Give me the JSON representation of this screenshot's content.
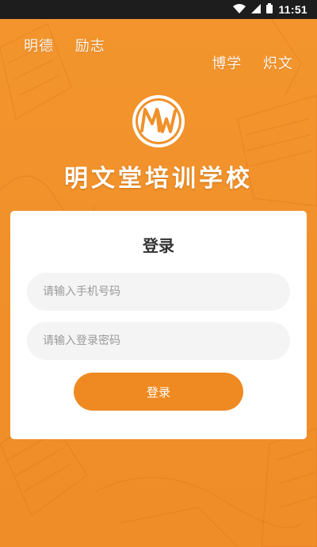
{
  "status_bar": {
    "time": "11:51",
    "icons": [
      "wifi-icon",
      "signal-icon",
      "battery-icon"
    ]
  },
  "motto": {
    "left": [
      "明德",
      "励志"
    ],
    "right": [
      "博学",
      "炽文"
    ]
  },
  "logo": {
    "icon": "mw-logo-icon",
    "letters": "MW"
  },
  "school_name": "明文堂培训学校",
  "login_card": {
    "title": "登录",
    "phone_placeholder": "请输入手机号码",
    "phone_value": "",
    "password_placeholder": "请输入登录密码",
    "password_value": "",
    "submit_label": "登录"
  },
  "colors": {
    "background": "#f0902a",
    "accent": "#ef8a22",
    "card": "#ffffff",
    "input_bg": "#f4f4f4"
  }
}
